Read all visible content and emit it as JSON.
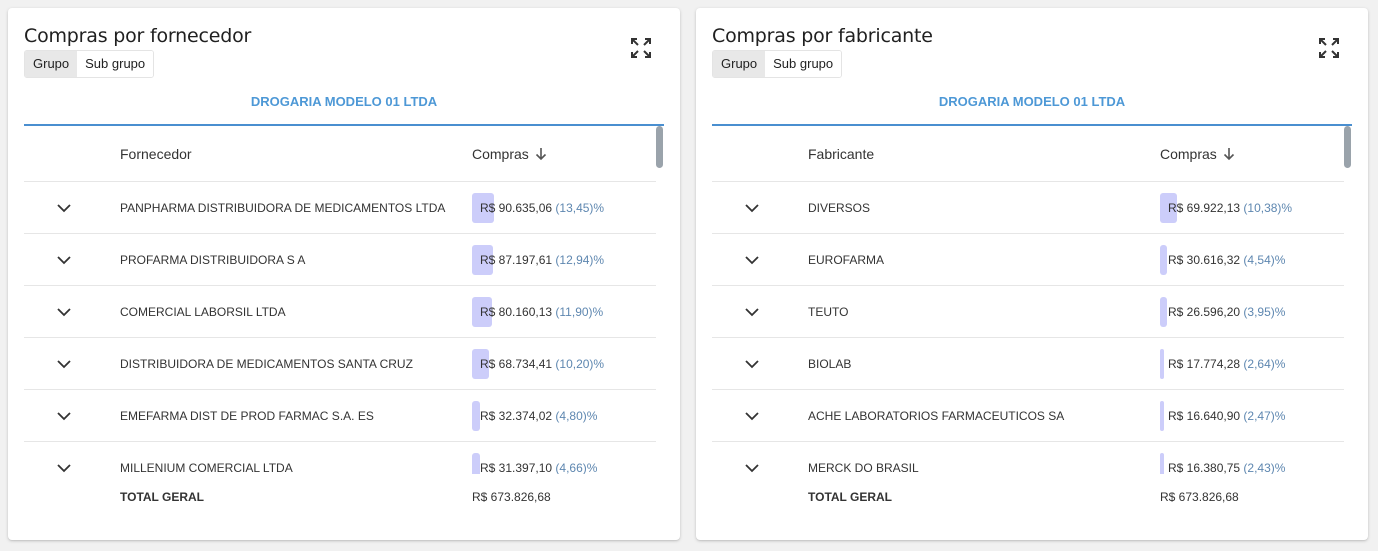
{
  "colors": {
    "accent": "#4a8fd0",
    "bar": "#cccdfa",
    "percent": "#5e87b0"
  },
  "panels": [
    {
      "title": "Compras por fornecedor",
      "expand_icon": "fullscreen-icon",
      "toggles": [
        "Grupo",
        "Sub grupo"
      ],
      "active_toggle": "Grupo",
      "tab": "DROGARIA MODELO 01 LTDA",
      "columns": {
        "name": "Fornecedor",
        "value": "Compras"
      },
      "sort_icon": "arrow-down-icon",
      "rows": [
        {
          "name": "PANPHARMA DISTRIBUIDORA DE MEDICAMENTOS LTDA",
          "value": "R$ 90.635,06",
          "pct": "(13,45)%",
          "share": 13.45
        },
        {
          "name": "PROFARMA DISTRIBUIDORA S A",
          "value": "R$ 87.197,61",
          "pct": "(12,94)%",
          "share": 12.94
        },
        {
          "name": "COMERCIAL LABORSIL LTDA",
          "value": "R$ 80.160,13",
          "pct": "(11,90)%",
          "share": 11.9
        },
        {
          "name": "DISTRIBUIDORA DE MEDICAMENTOS SANTA CRUZ",
          "value": "R$ 68.734,41",
          "pct": "(10,20)%",
          "share": 10.2
        },
        {
          "name": "EMEFARMA DIST DE PROD FARMAC S.A. ES",
          "value": "R$ 32.374,02",
          "pct": "(4,80)%",
          "share": 4.8
        },
        {
          "name": "MILLENIUM COMERCIAL LTDA",
          "value": "R$ 31.397,10",
          "pct": "(4,66)%",
          "share": 4.66
        }
      ],
      "total_label": "TOTAL GERAL",
      "total_value": "R$ 673.826,68"
    },
    {
      "title": "Compras por fabricante",
      "expand_icon": "fullscreen-icon",
      "toggles": [
        "Grupo",
        "Sub grupo"
      ],
      "active_toggle": "Grupo",
      "tab": "DROGARIA MODELO 01 LTDA",
      "columns": {
        "name": "Fabricante",
        "value": "Compras"
      },
      "sort_icon": "arrow-down-icon",
      "rows": [
        {
          "name": "DIVERSOS",
          "value": "R$ 69.922,13",
          "pct": "(10,38)%",
          "share": 10.38
        },
        {
          "name": "EUROFARMA",
          "value": "R$ 30.616,32",
          "pct": "(4,54)%",
          "share": 4.54
        },
        {
          "name": "TEUTO",
          "value": "R$ 26.596,20",
          "pct": "(3,95)%",
          "share": 3.95
        },
        {
          "name": "BIOLAB",
          "value": "R$ 17.774,28",
          "pct": "(2,64)%",
          "share": 2.64
        },
        {
          "name": "ACHE LABORATORIOS FARMACEUTICOS SA",
          "value": "R$ 16.640,90",
          "pct": "(2,47)%",
          "share": 2.47
        },
        {
          "name": "MERCK DO BRASIL",
          "value": "R$ 16.380,75",
          "pct": "(2,43)%",
          "share": 2.43
        }
      ],
      "total_label": "TOTAL GERAL",
      "total_value": "R$ 673.826,68"
    }
  ]
}
